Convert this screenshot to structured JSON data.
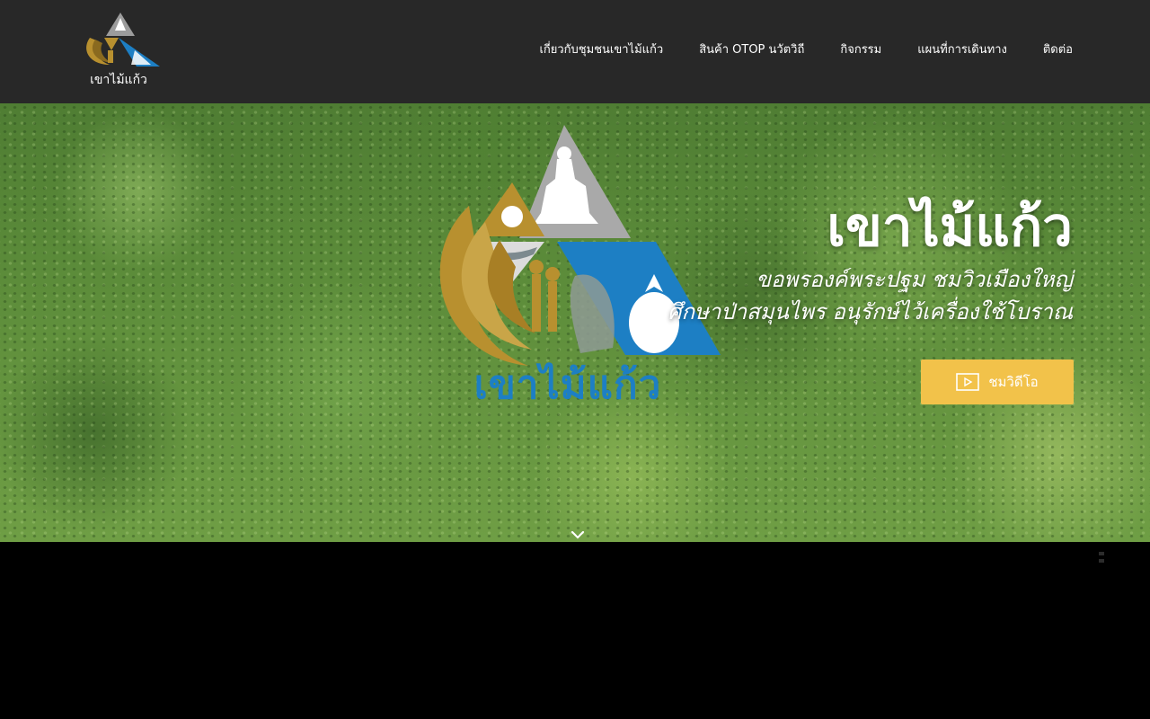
{
  "header": {
    "logo_text": "เขาไม้แก้ว",
    "nav": [
      {
        "label": "เกี่ยวกับชุมชนเขาไม้แก้ว"
      },
      {
        "label": "สินค้า OTOP นวัตวิถี"
      },
      {
        "label": "กิจกรรม"
      },
      {
        "label": "แผนที่การเดินทาง"
      },
      {
        "label": "ติดต่อ"
      }
    ]
  },
  "hero": {
    "emblem_text": "เขาไม้แก้ว",
    "title": "เขาไม้แก้ว",
    "subtitle_line1": "ขอพรองค์พระปฐม ชมวิวเมืองใหญ่",
    "subtitle_line2": "ศึกษาป่าสมุนไพร อนุรักษ์ไว้เครื่องใช้โบราณ",
    "video_button_label": "ชมวิดีโอ",
    "icons": {
      "play": "play-icon",
      "scroll": "chevron-down-icon"
    }
  },
  "colors": {
    "header_bg": "#282828",
    "accent": "#f2c24a",
    "brand_blue": "#1d7fc4",
    "brand_gold": "#b8902f"
  }
}
